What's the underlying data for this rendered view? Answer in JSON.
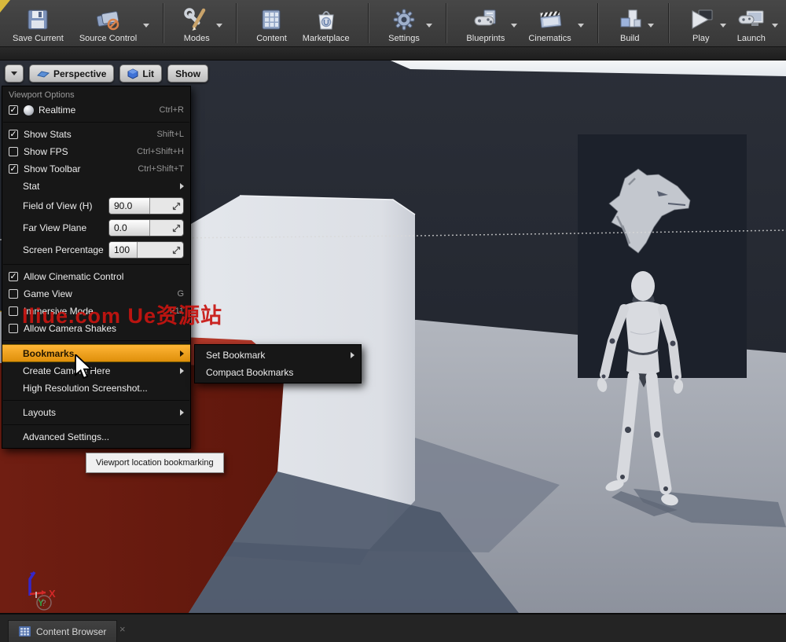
{
  "toolbar": {
    "groups": [
      {
        "buttons": [
          {
            "label": "Save Current",
            "icon": "save",
            "dropdown": false
          },
          {
            "label": "Source Control",
            "icon": "source-control",
            "dropdown": true
          }
        ]
      },
      {
        "buttons": [
          {
            "label": "Modes",
            "icon": "modes",
            "dropdown": true
          }
        ]
      },
      {
        "buttons": [
          {
            "label": "Content",
            "icon": "content",
            "dropdown": false
          },
          {
            "label": "Marketplace",
            "icon": "marketplace",
            "dropdown": false
          }
        ]
      },
      {
        "buttons": [
          {
            "label": "Settings",
            "icon": "settings",
            "dropdown": true
          }
        ]
      },
      {
        "buttons": [
          {
            "label": "Blueprints",
            "icon": "blueprints",
            "dropdown": true
          },
          {
            "label": "Cinematics",
            "icon": "cinematics",
            "dropdown": true
          }
        ]
      },
      {
        "buttons": [
          {
            "label": "Build",
            "icon": "build",
            "dropdown": true
          }
        ]
      },
      {
        "buttons": [
          {
            "label": "Play",
            "icon": "play",
            "dropdown": true
          },
          {
            "label": "Launch",
            "icon": "launch",
            "dropdown": true
          }
        ]
      }
    ]
  },
  "viewport_toolbar": {
    "perspective": "Perspective",
    "lit": "Lit",
    "show": "Show"
  },
  "viewport_menu": {
    "title": "Viewport Options",
    "items": [
      {
        "type": "check",
        "label": "Realtime",
        "checked": true,
        "icon": "realtime-sphere",
        "shortcut": "Ctrl+R"
      },
      {
        "type": "sep"
      },
      {
        "type": "check",
        "label": "Show Stats",
        "checked": true,
        "shortcut": "Shift+L"
      },
      {
        "type": "check",
        "label": "Show FPS",
        "checked": false,
        "shortcut": "Ctrl+Shift+H"
      },
      {
        "type": "check",
        "label": "Show Toolbar",
        "checked": true,
        "shortcut": "Ctrl+Shift+T"
      },
      {
        "type": "submenu",
        "label": "Stat"
      },
      {
        "type": "spin",
        "label": "Field of View (H)",
        "value": "90.0",
        "fill": 0.55
      },
      {
        "type": "spin",
        "label": "Far View Plane",
        "value": "0.0",
        "fill": 0.55
      },
      {
        "type": "spin",
        "label": "Screen Percentage",
        "value": "100",
        "fill": 0.38
      },
      {
        "type": "sep"
      },
      {
        "type": "check",
        "label": "Allow Cinematic Control",
        "checked": true,
        "shortcut": ""
      },
      {
        "type": "check",
        "label": "Game View",
        "checked": false,
        "shortcut": "G"
      },
      {
        "type": "check",
        "label": "Immersive Mode",
        "checked": false,
        "shortcut": "F11"
      },
      {
        "type": "check",
        "label": "Allow Camera Shakes",
        "checked": false,
        "shortcut": ""
      },
      {
        "type": "sep"
      },
      {
        "type": "submenu",
        "label": "Bookmarks",
        "highlighted": true
      },
      {
        "type": "submenu",
        "label": "Create Camera Here"
      },
      {
        "type": "action",
        "label": "High Resolution Screenshot..."
      },
      {
        "type": "sep"
      },
      {
        "type": "submenu",
        "label": "Layouts"
      },
      {
        "type": "sep"
      },
      {
        "type": "action",
        "label": "Advanced Settings..."
      }
    ]
  },
  "bookmarks_submenu": {
    "items": [
      {
        "label": "Set Bookmark",
        "has_submenu": true
      },
      {
        "label": "Compact Bookmarks",
        "has_submenu": false
      }
    ]
  },
  "tooltip": {
    "text": "Viewport location bookmarking"
  },
  "watermark": {
    "text": "Iliue.com Ue资源站",
    "color": "#c81410"
  },
  "axis_gizmo": {
    "x_label": "X",
    "y_label": "Y",
    "origin_mark": "?"
  },
  "bottom_bar": {
    "tab_label": "Content Browser",
    "close_label": "×"
  },
  "colors": {
    "menu_highlight": "#f2a41c",
    "viewport_border": "#bd9c30",
    "sky": "#e9edf1",
    "wall": "#272b34",
    "dragon_panel": "#1c212b",
    "floor": "#a4a8b1",
    "red_cube_top": "#b5392a",
    "red_cube_front": "#6f1d11",
    "mannequin_body": "#d7d9de"
  }
}
